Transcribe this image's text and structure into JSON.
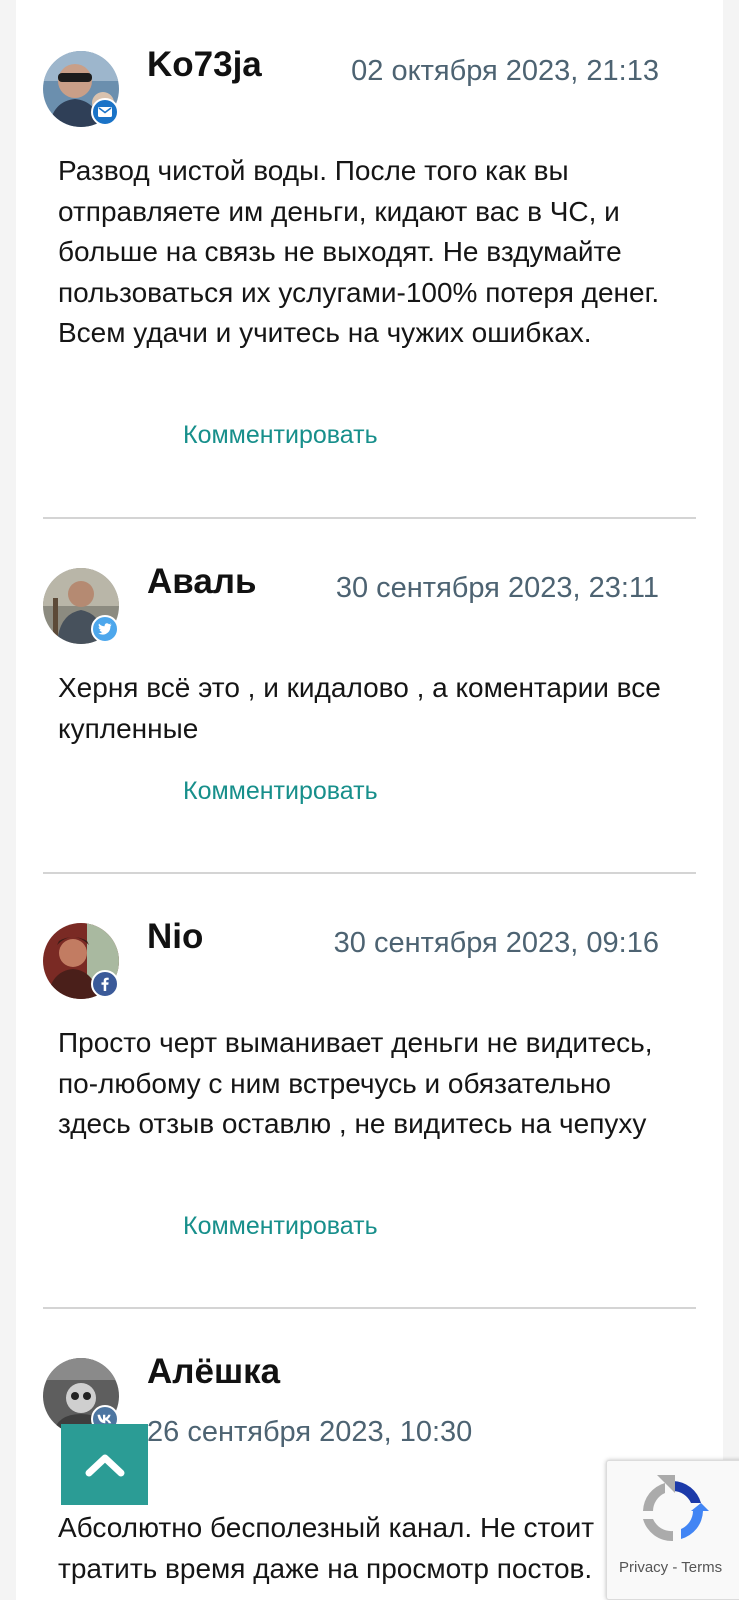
{
  "comments": [
    {
      "author": "Ko73ja",
      "date": "02 октября 2023, 21:13",
      "text": "Развод чистой воды. После того как вы отправляете им деньги, кидают вас в ЧС, и больше на связь не выходят. Не вздумайте пользоваться их услугами-100% потеря денег. Всем удачи и учитесь на чужих ошибках.",
      "reply_label": "Комментировать",
      "social_icon": "mail-icon",
      "social_color": "#1a73c7"
    },
    {
      "author": "Аваль",
      "date": "30 сентября 2023, 23:11",
      "text": "Херня всё это , и кидалово , а коментарии все купленные",
      "reply_label": "Комментировать",
      "social_icon": "twitter-icon",
      "social_color": "#4da7ec"
    },
    {
      "author": "Nio",
      "date": "30 сентября 2023, 09:16",
      "text": "Просто черт выманивает деньги не видитесь, по-любому с ним встречусь и обязательно здесь отзыв оставлю , не видитесь на чепуху",
      "reply_label": "Комментировать",
      "social_icon": "facebook-icon",
      "social_color": "#3b5a99"
    },
    {
      "author": "Алёшка",
      "date": "26 сентября 2023, 10:30",
      "text": "Абсолютно бесполезный канал. Не стоит тратить время даже на просмотр постов.",
      "social_icon": "vk-icon",
      "social_color": "#4d76a1"
    }
  ],
  "recaptcha": {
    "privacy_label": "Privacy",
    "separator": " - ",
    "terms_label": "Terms"
  },
  "colors": {
    "accent": "#2b9c95",
    "link": "#178f8b",
    "date": "#4d6372"
  }
}
